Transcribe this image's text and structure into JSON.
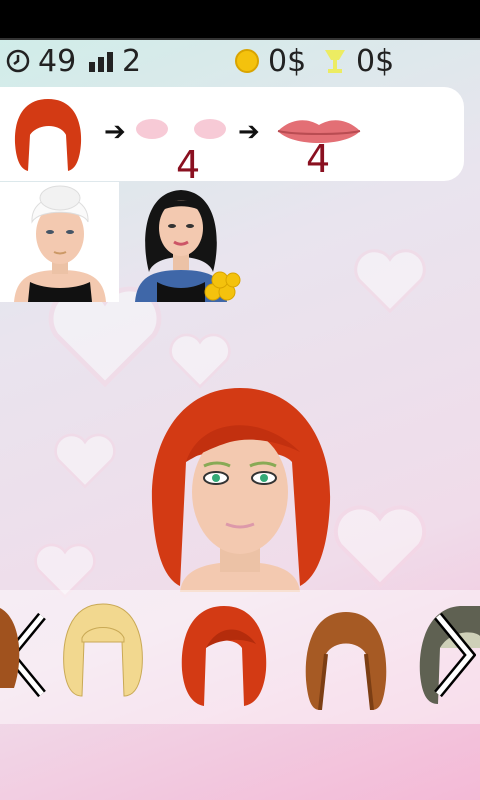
{
  "hud": {
    "timer": "49",
    "level": "2",
    "coins": "0$",
    "trophy": "0$"
  },
  "recipe": {
    "step1_item": "red-bob-wig",
    "step2_item": "blush",
    "step2_count": "4",
    "step3_item": "lips",
    "step3_count": "4"
  },
  "clients": [
    "towel-client",
    "dark-hair-client"
  ],
  "carousel": {
    "items": [
      "brown-wig",
      "blonde-wig",
      "red-wig",
      "braided-wig",
      "gray-wig"
    ]
  },
  "colors": {
    "accent_red": "#d33a14",
    "count_color": "#8a1020",
    "coin_gold": "#f4c20d"
  }
}
